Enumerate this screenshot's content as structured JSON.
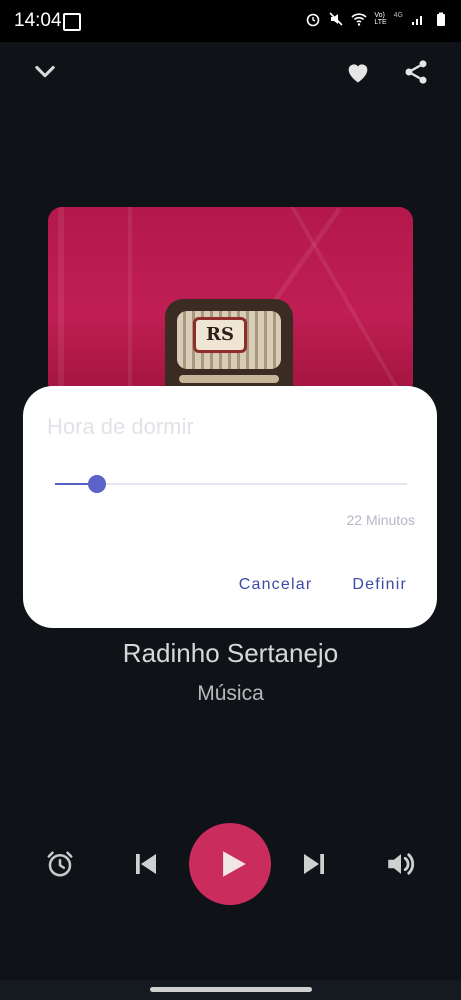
{
  "status_bar": {
    "time": "14:04",
    "signal_text": "Vo)\nLTE",
    "net_type": "4G",
    "icons": [
      "gallery-icon",
      "alarm-icon",
      "mute-icon",
      "wifi-icon",
      "signal-icon",
      "battery-icon"
    ]
  },
  "top_bar": {
    "icons": [
      "chevron-down-icon",
      "heart-icon",
      "share-icon"
    ]
  },
  "sleep_dialog": {
    "title": "Hora de dormir",
    "slider_value_text": "22 Minutos",
    "slider_fraction": 0.12,
    "cancel_label": "Cancelar",
    "confirm_label": "Definir",
    "accent_color": "#5b63c8"
  },
  "track": {
    "title": "Radinho Sertanejo",
    "subtitle": "Música",
    "album_text": "RS"
  },
  "controls": {
    "icons": [
      "alarm-clock-icon",
      "skip-previous-icon",
      "play-icon",
      "skip-next-icon",
      "volume-icon"
    ],
    "play_color": "#c92c5d"
  }
}
